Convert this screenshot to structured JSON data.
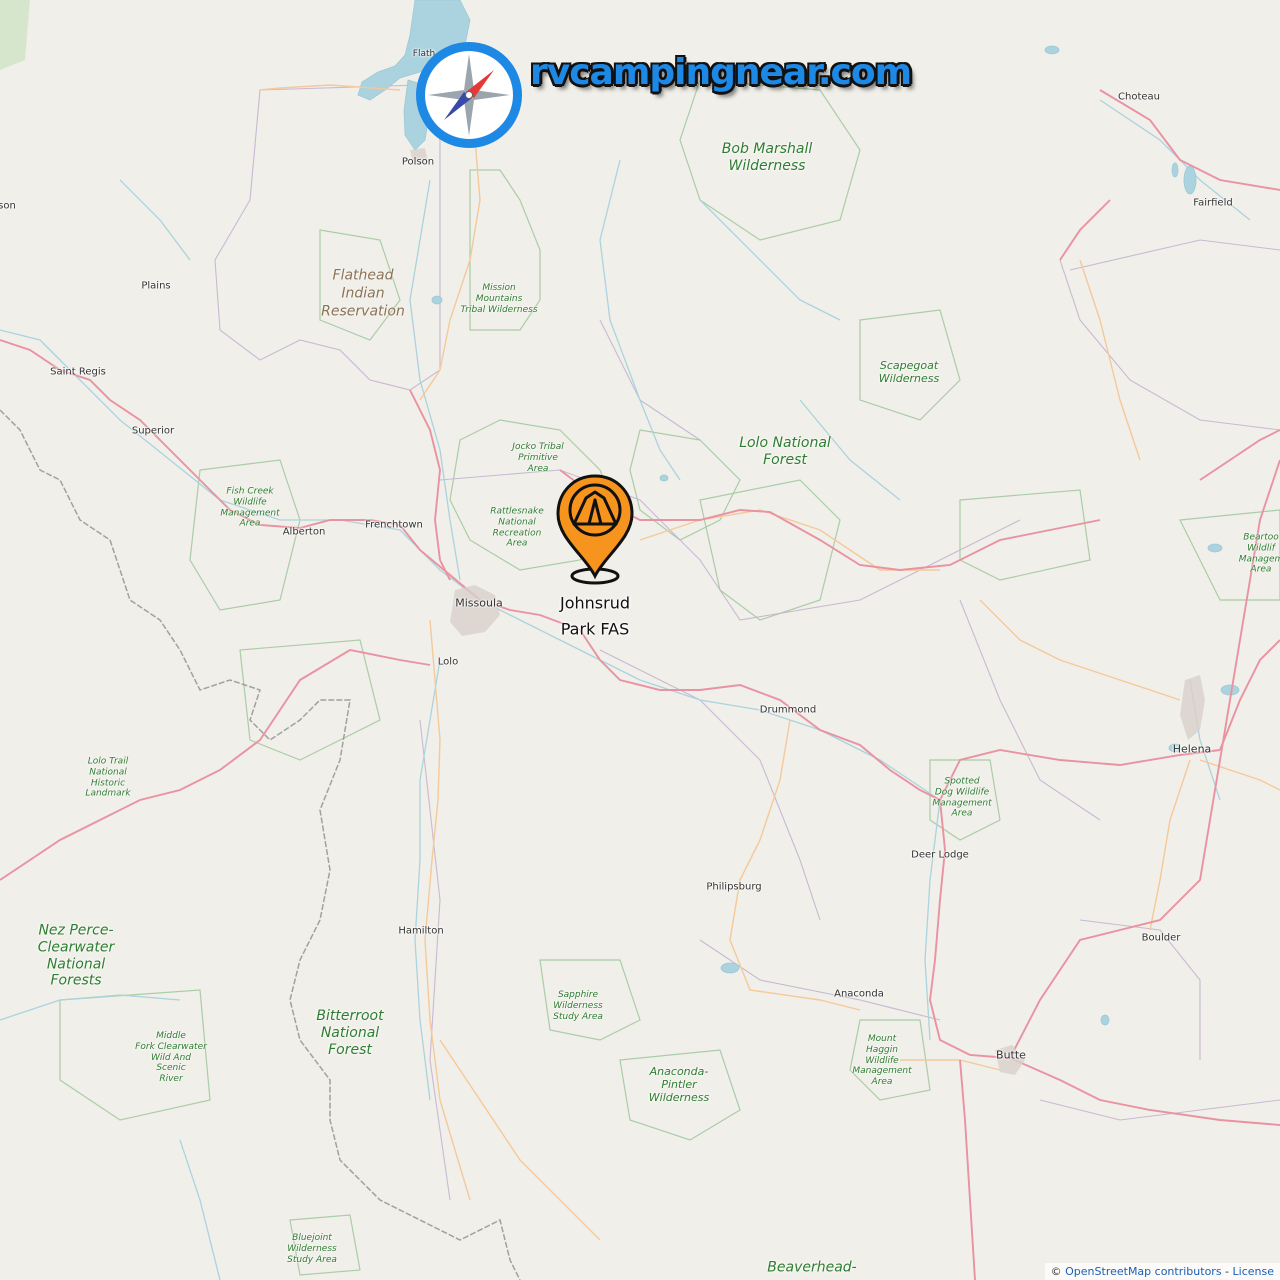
{
  "site": {
    "logo_text": "rvcampingnear.com",
    "brand_color": "#1e88e5"
  },
  "marker": {
    "name": "Johnsrud\nPark FAS",
    "icon": "tent-pin-icon",
    "color": "#f7941d"
  },
  "cities": {
    "polson": "Polson",
    "choteau": "Choteau",
    "fairfield": "Fairfield",
    "plains": "Plains",
    "saint_regis": "Saint Regis",
    "superior": "Superior",
    "alberton": "Alberton",
    "frenchtown": "Frenchtown",
    "missoula": "Missoula",
    "lolo": "Lolo",
    "drummond": "Drummond",
    "helena": "Helena",
    "deer_lodge": "Deer Lodge",
    "philipsburg": "Philipsburg",
    "hamilton": "Hamilton",
    "boulder": "Boulder",
    "anaconda": "Anaconda",
    "butte": "Butte",
    "edge_son": "son",
    "flathead_lake_fragment": "Flath"
  },
  "areas": {
    "bob_marshall": "Bob Marshall\nWilderness",
    "flathead_indian": "Flathead\nIndian\nReservation",
    "mission_mountains": "Mission\nMountains\nTribal Wilderness",
    "scapegoat": "Scapegoat\nWilderness",
    "jocko": "Jocko Tribal\nPrimitive\nArea",
    "lolo_nf": "Lolo National\nForest",
    "rattlesnake": "Rattlesnake\nNational\nRecreation\nArea",
    "fish_creek": "Fish Creek\nWildlife\nManagement\nArea",
    "beartooth": "Beartoo\nWildlif\nManagem\nArea",
    "lolo_trail": "Lolo Trail\nNational\nHistoric\nLandmark",
    "spotted_dog": "Spotted\nDog Wildlife\nManagement\nArea",
    "nez_perce": "Nez Perce-\nClearwater\nNational\nForests",
    "bitterroot": "Bitterroot\nNational\nForest",
    "sapphire": "Sapphire\nWilderness\nStudy Area",
    "middle_fork": "Middle\nFork Clearwater\nWild And\nScenic\nRiver",
    "mount_haggin": "Mount\nHaggin\nWildlife\nManagement\nArea",
    "anaconda_pintler": "Anaconda-\nPintler\nWilderness",
    "bluejoint": "Bluejoint\nWilderness\nStudy Area",
    "beaverhead": "Beaverhead-"
  },
  "attribution": {
    "prefix": "© ",
    "osm": "OpenStreetMap contributors",
    "sep": " - ",
    "license": "License"
  },
  "colors": {
    "land": "#f1efe9",
    "water": "#aad3df",
    "interstate": "#e892a2",
    "secondary_road": "#f5c99a",
    "protected_boundary": "#a3c9a0",
    "county_boundary": "#b9a8c8",
    "state_boundary": "#8d8d8d"
  }
}
